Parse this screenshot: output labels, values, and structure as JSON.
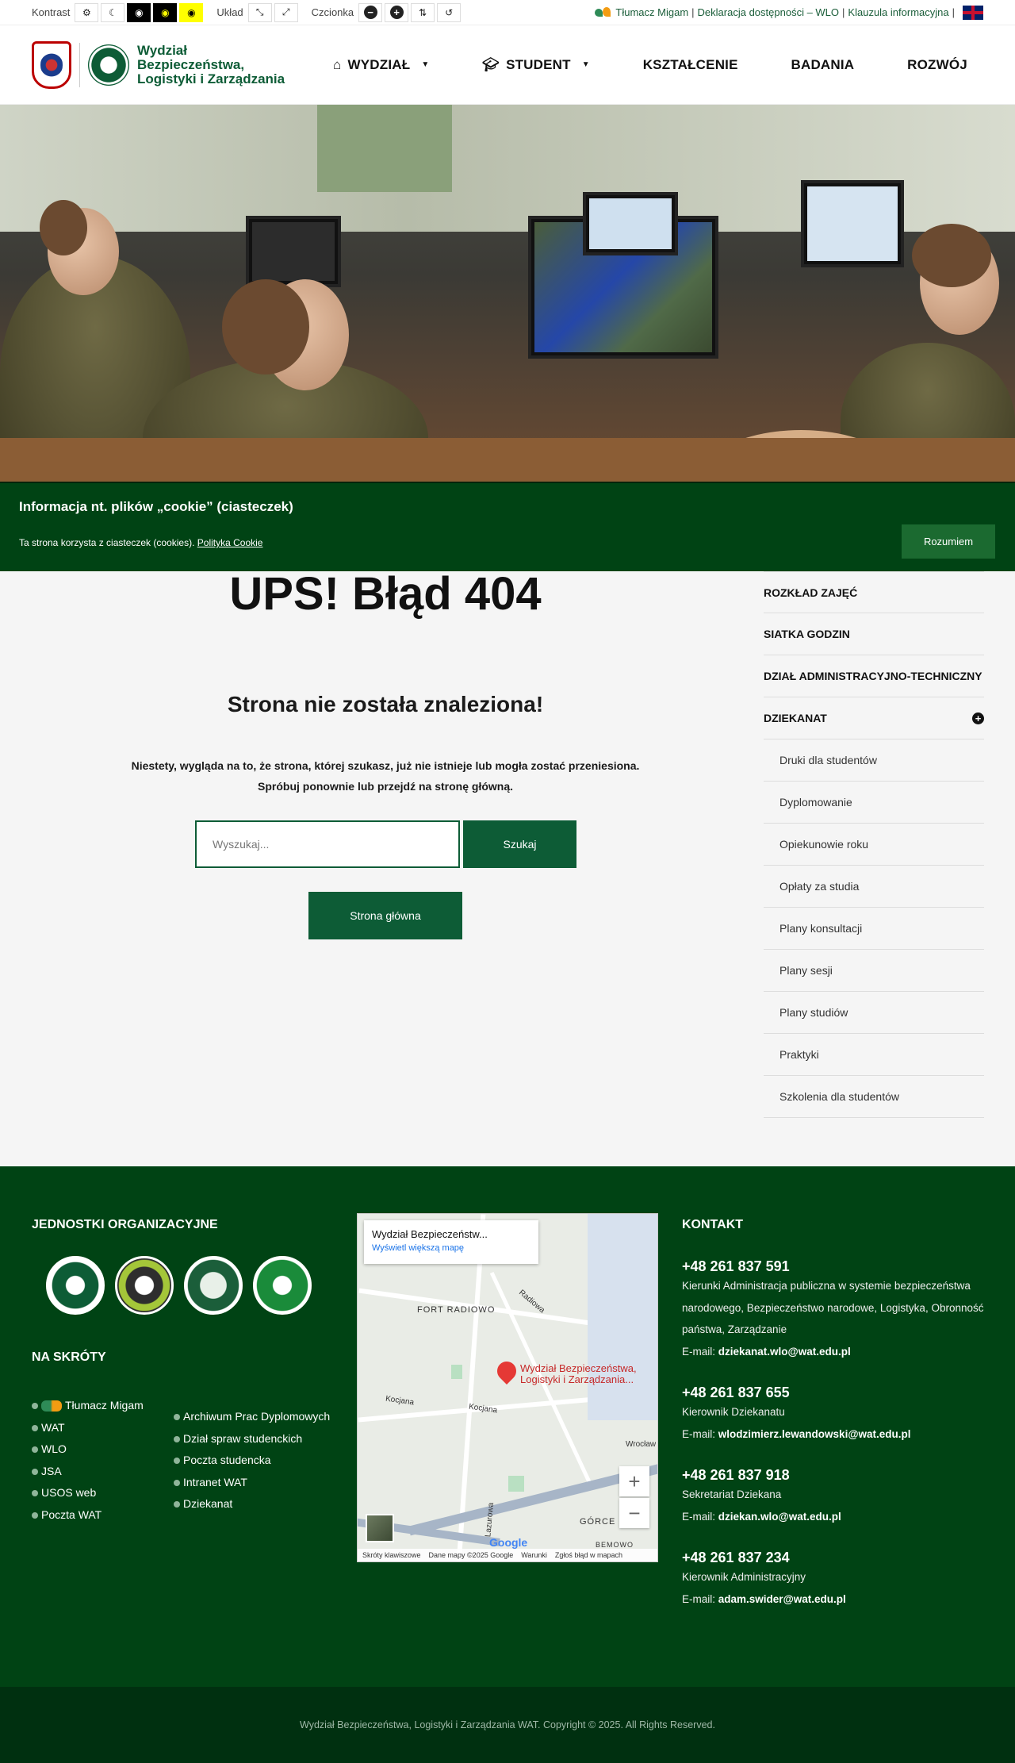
{
  "a11y": {
    "contrast_label": "Kontrast",
    "layout_label": "Układ",
    "font_label": "Czcionka",
    "right_links": {
      "migam": "Tłumacz Migam",
      "sep1": "|",
      "declaration": "Deklaracja dostępności – WLO",
      "sep2": "|",
      "clause": "Klauzula informacyjna",
      "sep3": "|"
    }
  },
  "header": {
    "logo_text_line1": "Wydział",
    "logo_text_line2": "Bezpieczeństwa,",
    "logo_text_line3": "Logistyki i Zarządzania",
    "nav": [
      {
        "label": "WYDZIAŁ",
        "icon": "home-icon",
        "dropdown": true
      },
      {
        "label": "STUDENT",
        "icon": "graduation-cap-icon",
        "dropdown": true
      },
      {
        "label": "KSZTAŁCENIE"
      },
      {
        "label": "BADANIA"
      },
      {
        "label": "ROZWÓJ"
      }
    ]
  },
  "cookie": {
    "title": "Informacja nt. plików „cookie” (ciasteczek)",
    "text": "Ta strona korzysta z ciasteczek (cookies).",
    "policy_link": "Polityka Cookie",
    "accept_label": "Rozumiem"
  },
  "error": {
    "title": "UPS! Błąd 404",
    "subtitle": "Strona nie została znaleziona!",
    "message_line1": "Niestety, wygląda na to, że strona, której szukasz, już nie istnieje lub mogła zostać przeniesiona.",
    "message_line2": "Spróbuj ponownie lub przejdź na stronę główną.",
    "search_placeholder": "Wyszukaj...",
    "search_button": "Szukaj",
    "home_button": "Strona główna"
  },
  "sidebar": {
    "items": [
      "ROZKŁAD ZAJĘĆ",
      "SIATKA GODZIN",
      "DZIAŁ ADMINISTRACYJNO-TECHNICZNY",
      "DZIEKANAT"
    ],
    "subitems": [
      "Druki dla studentów",
      "Dyplomowanie",
      "Opiekunowie roku",
      "Opłaty za studia",
      "Plany konsultacji",
      "Plany sesji",
      "Plany studiów",
      "Praktyki",
      "Szkolenia dla studentów"
    ]
  },
  "footer": {
    "units_title": "JEDNOSTKI ORGANIZACYJNE",
    "shortcuts_title": "NA SKRÓTY",
    "shortcuts_col1": [
      "Tłumacz Migam",
      "WAT",
      "WLO",
      "JSA",
      "USOS web",
      "Poczta WAT"
    ],
    "shortcuts_col2": [
      "Archiwum Prac Dyplomowych",
      "Dział spraw studenckich",
      "Poczta studencka",
      "Intranet WAT",
      "Dziekanat"
    ],
    "map": {
      "card_title": "Wydział Bezpieczeństw...",
      "card_link": "Wyświetl większą mapę",
      "place_label": "Wydział Bezpieczeństwa, Logistyki i Zarządzania...",
      "area1": "FORT RADIOWO",
      "area2": "GÓRCE",
      "area3": "BEMOWO",
      "street1": "Radiowa",
      "street2": "Kocjana",
      "street3": "Kocjana",
      "street4": "Lazurowa",
      "street5": "Wrocław",
      "bottom": [
        "Skróty klawiszowe",
        "Dane mapy ©2025 Google",
        "Warunki",
        "Zgłoś błąd w mapach"
      ],
      "zoom_in": "+",
      "zoom_out": "−",
      "google": "Google"
    },
    "contact_title": "KONTAKT",
    "contacts": [
      {
        "phone": "+48 261 837 591",
        "desc": "Kierunki Administracja publiczna w systemie bezpieczeństwa narodowego, Bezpieczeństwo narodowe, Logistyka, Obronność państwa, Zarządzanie",
        "email_label": "E-mail:",
        "email": "dziekanat.wlo@wat.edu.pl"
      },
      {
        "phone": "+48 261 837 655",
        "desc": "Kierownik Dziekanatu",
        "email_label": "E-mail:",
        "email": "wlodzimierz.lewandowski@wat.edu.pl"
      },
      {
        "phone": "+48 261 837 918",
        "desc": "Sekretariat Dziekana",
        "email_label": "E-mail:",
        "email": "dziekan.wlo@wat.edu.pl"
      },
      {
        "phone": "+48 261 837 234",
        "desc": "Kierownik Administracyjny",
        "email_label": "E-mail:",
        "email": "adam.swider@wat.edu.pl"
      }
    ],
    "copyright": "Wydział Bezpieczeństwa, Logistyki i Zarządzania WAT. Copyright © 2025. All Rights Reserved."
  },
  "colors": {
    "primary": "#0d5c36",
    "footer": "#004314",
    "cookie": "#004314"
  }
}
